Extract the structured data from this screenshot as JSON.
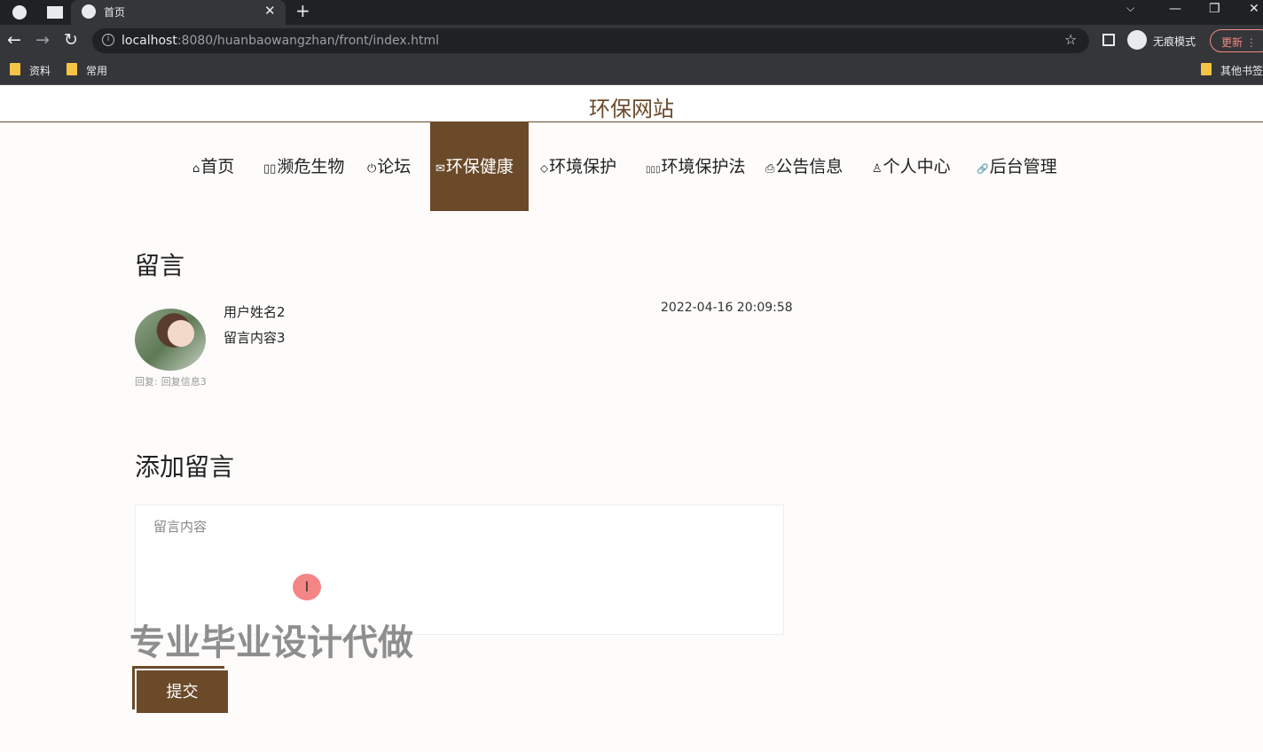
{
  "browser": {
    "tab_title": "首页",
    "new_tab_symbol": "+",
    "close_symbol": "✕",
    "url_host": "localhost",
    "url_rest": ":8080/huanbaowangzhan/front/index.html",
    "incognito_label": "无痕模式",
    "update_label": "更新",
    "bookmarks": [
      "资料",
      "常用"
    ],
    "other_bookmarks": "其他书签"
  },
  "site": {
    "title": "环保网站"
  },
  "nav": {
    "items": [
      {
        "icon": "home-icon",
        "glyph": "⌂",
        "label": "首页"
      },
      {
        "icon": "species-icon",
        "glyph": "▯▯",
        "label": "濒危生物"
      },
      {
        "icon": "forum-icon",
        "glyph": "⏻",
        "label": "论坛"
      },
      {
        "icon": "mail-icon",
        "glyph": "✉",
        "label": "环保健康",
        "active": true
      },
      {
        "icon": "tag-icon",
        "glyph": "⬦",
        "label": "环境保护"
      },
      {
        "icon": "grid-icon",
        "glyph": "▯▯▯",
        "label": "环境保护法"
      },
      {
        "icon": "printer-icon",
        "glyph": "⎙",
        "label": "公告信息"
      },
      {
        "icon": "user-icon",
        "glyph": "♙",
        "label": "个人中心"
      },
      {
        "icon": "link-icon",
        "glyph": "🔗",
        "label": "后台管理"
      }
    ]
  },
  "messages": {
    "title": "留言",
    "items": [
      {
        "user": "用户姓名2",
        "content": "留言内容3",
        "time": "2022-04-16 20:09:58",
        "reply_label": "回复:",
        "reply": "回复信息3"
      }
    ]
  },
  "add_message": {
    "title": "添加留言",
    "placeholder": "留言内容",
    "submit_label": "提交"
  },
  "cursor_glyph": "I",
  "watermark": "专业毕业设计代做",
  "colors": {
    "accent": "#6b4a2a",
    "page_bg": "#fdfcfa"
  }
}
